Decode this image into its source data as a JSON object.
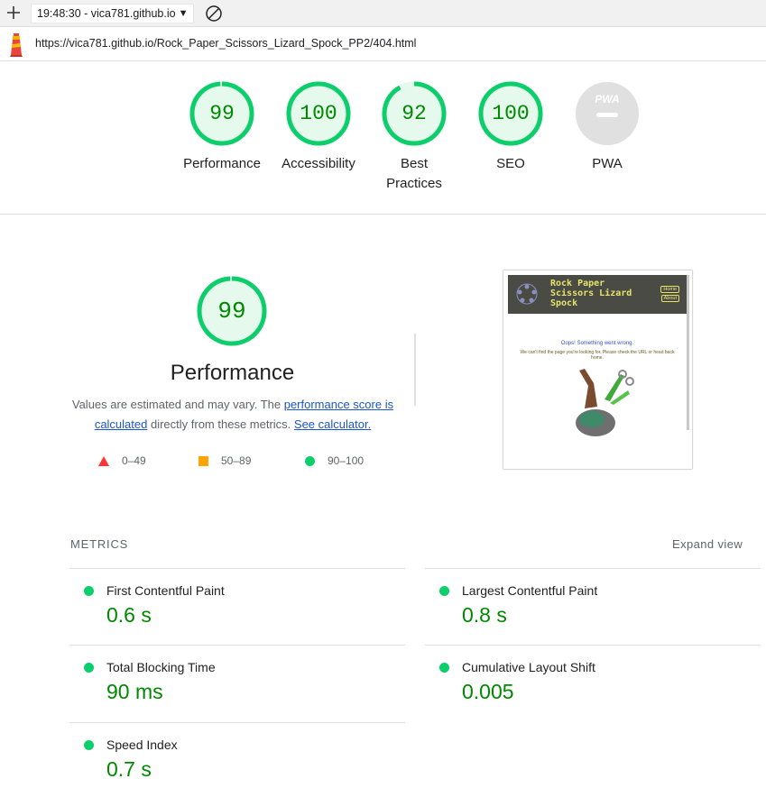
{
  "toolbar": {
    "session_label": "19:48:30 - vica781.github.io"
  },
  "urlbar": {
    "url": "https://vica781.github.io/Rock_Paper_Scissors_Lizard_Spock_PP2/404.html"
  },
  "colors": {
    "pass": "#0cce6b",
    "pass_text": "#008800",
    "pass_fill": "#e6f9ed",
    "average": "#ffa400",
    "fail": "#ff3333",
    "na": "#e0e0e0"
  },
  "categories": [
    {
      "score": "99",
      "label": "Performance",
      "fraction": 0.99
    },
    {
      "score": "100",
      "label": "Accessibility",
      "fraction": 1.0
    },
    {
      "score": "92",
      "label": "Best Practices",
      "fraction": 0.92
    },
    {
      "score": "100",
      "label": "SEO",
      "fraction": 1.0
    },
    {
      "score": "",
      "label": "PWA",
      "badge": "PWA"
    }
  ],
  "performance": {
    "score": "99",
    "fraction": 0.99,
    "title": "Performance",
    "desc_prefix": "Values are estimated and may vary. The ",
    "desc_link1": "performance score is calculated",
    "desc_middle": " directly from these metrics. ",
    "desc_link2": "See calculator.",
    "legend": [
      {
        "range": "0–49",
        "shape": "triangle-icon",
        "color": "#ff3333"
      },
      {
        "range": "50–89",
        "shape": "square-icon",
        "color": "#ffa400"
      },
      {
        "range": "90–100",
        "shape": "circle-icon",
        "color": "#0cce6b"
      }
    ]
  },
  "screenshot": {
    "title": "Rock Paper Scissors Lizard Spock",
    "nav_home": "Home",
    "nav_about": "About",
    "oops": "Oops! Something went wrong.",
    "message": "We can't find the page you're looking for. Please check the URL or head back home."
  },
  "metrics": {
    "heading": "METRICS",
    "expand": "Expand view",
    "items": [
      {
        "name": "First Contentful Paint",
        "value": "0.6 s"
      },
      {
        "name": "Largest Contentful Paint",
        "value": "0.8 s"
      },
      {
        "name": "Total Blocking Time",
        "value": "90 ms"
      },
      {
        "name": "Cumulative Layout Shift",
        "value": "0.005"
      },
      {
        "name": "Speed Index",
        "value": "0.7 s"
      }
    ]
  }
}
